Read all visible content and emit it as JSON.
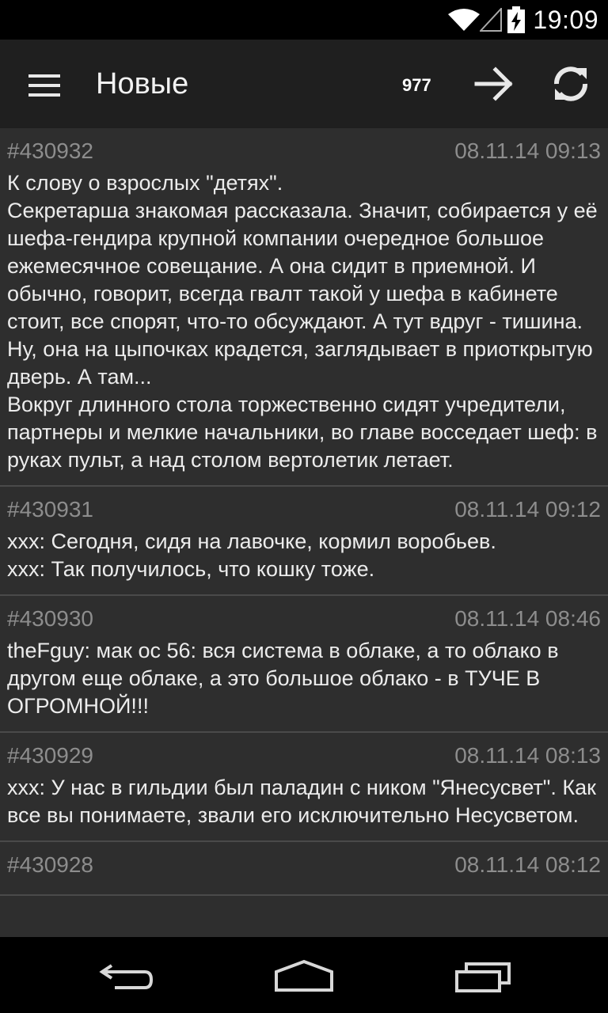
{
  "status_bar": {
    "time": "19:09",
    "icons": [
      "wifi-icon",
      "signal-icon",
      "battery-charging-icon"
    ]
  },
  "action_bar": {
    "title": "Новые",
    "count": "977",
    "icons": [
      "menu-icon",
      "arrow-right-icon",
      "refresh-icon"
    ]
  },
  "quotes": [
    {
      "id": "#430932",
      "date": "08.11.14 09:13",
      "text": "К слову о взрослых \"детях\".\nСекретарша знакомая рассказала. Значит, собирается у её шефа-гендира крупной компании очередное большое ежемесячное совещание. А она сидит в приемной. И обычно, говорит, всегда гвалт такой у шефа в кабинете стоит, все спорят, что-то обсуждают. А тут вдруг - тишина.\nНу, она на цыпочках крадется, заглядывает в приоткрытую дверь. А там...\nВокруг длинного стола торжественно сидят учредители, партнеры и мелкие начальники, во главе восседает шеф: в руках пульт, а над столом вертолетик летает."
    },
    {
      "id": "#430931",
      "date": "08.11.14 09:12",
      "text": "xxx: Сегодня, сидя на лавочке, кормил воробьев.\nxxx: Так получилось, что кошку тоже."
    },
    {
      "id": "#430930",
      "date": "08.11.14 08:46",
      "text": "theFguy: мак ос 56: вся система в облаке, а то облако в другом еще облаке, а это большое облако - в ТУЧЕ В ОГРОМНОЙ!!!"
    },
    {
      "id": "#430929",
      "date": "08.11.14 08:13",
      "text": "xxx: У нас в гильдии был паладин с ником \"Янесусвет\". Как все вы понимаете, звали его исключительно Несусветом."
    },
    {
      "id": "#430928",
      "date": "08.11.14 08:12",
      "text": ""
    }
  ],
  "nav_bar": {
    "icons": [
      "back-icon",
      "home-icon",
      "recents-icon"
    ]
  }
}
